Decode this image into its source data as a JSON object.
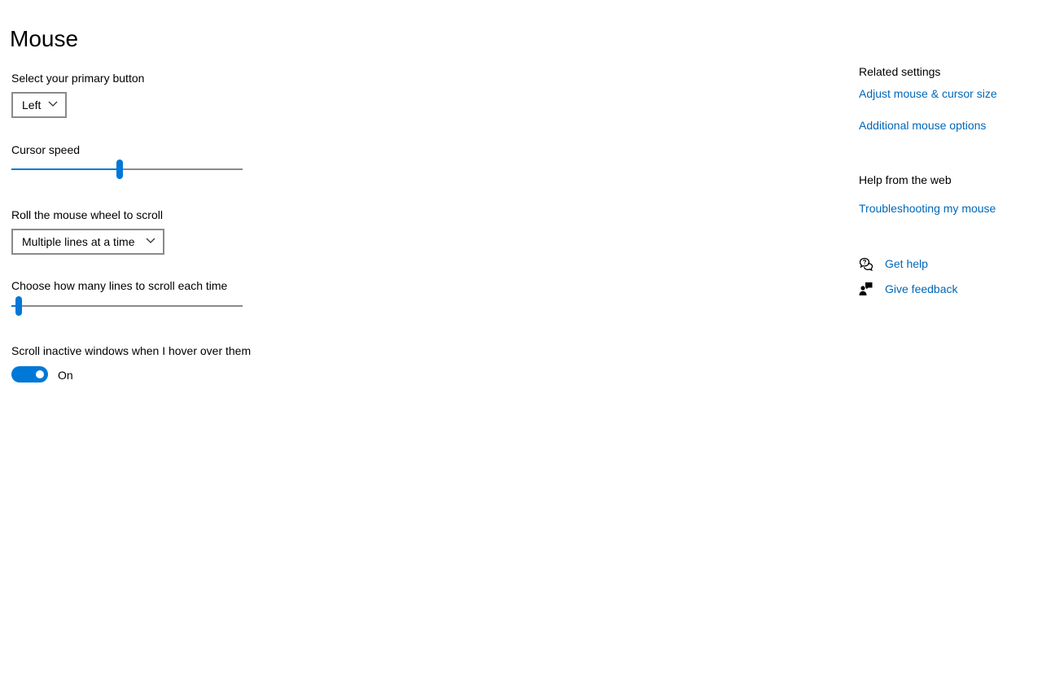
{
  "page": {
    "title": "Mouse"
  },
  "settings": {
    "primary_button": {
      "label": "Select your primary button",
      "value": "Left"
    },
    "cursor_speed": {
      "label": "Cursor speed",
      "value_fraction": 0.47
    },
    "wheel_scroll": {
      "label": "Roll the mouse wheel to scroll",
      "value": "Multiple lines at a time"
    },
    "lines_to_scroll": {
      "label": "Choose how many lines to scroll each time",
      "value_fraction": 0.03
    },
    "scroll_inactive": {
      "label": "Scroll inactive windows when I hover over them",
      "state": "On"
    }
  },
  "related": {
    "heading": "Related settings",
    "links": [
      "Adjust mouse & cursor size",
      "Additional mouse options"
    ]
  },
  "help_web": {
    "heading": "Help from the web",
    "links": [
      "Troubleshooting my mouse"
    ]
  },
  "support": {
    "get_help": "Get help",
    "give_feedback": "Give feedback",
    "get_help_icon": "chat-question-icon",
    "give_feedback_icon": "feedback-person-icon"
  },
  "colors": {
    "accent": "#0078d7",
    "link": "#0067b8",
    "border": "#8a8a8a"
  }
}
